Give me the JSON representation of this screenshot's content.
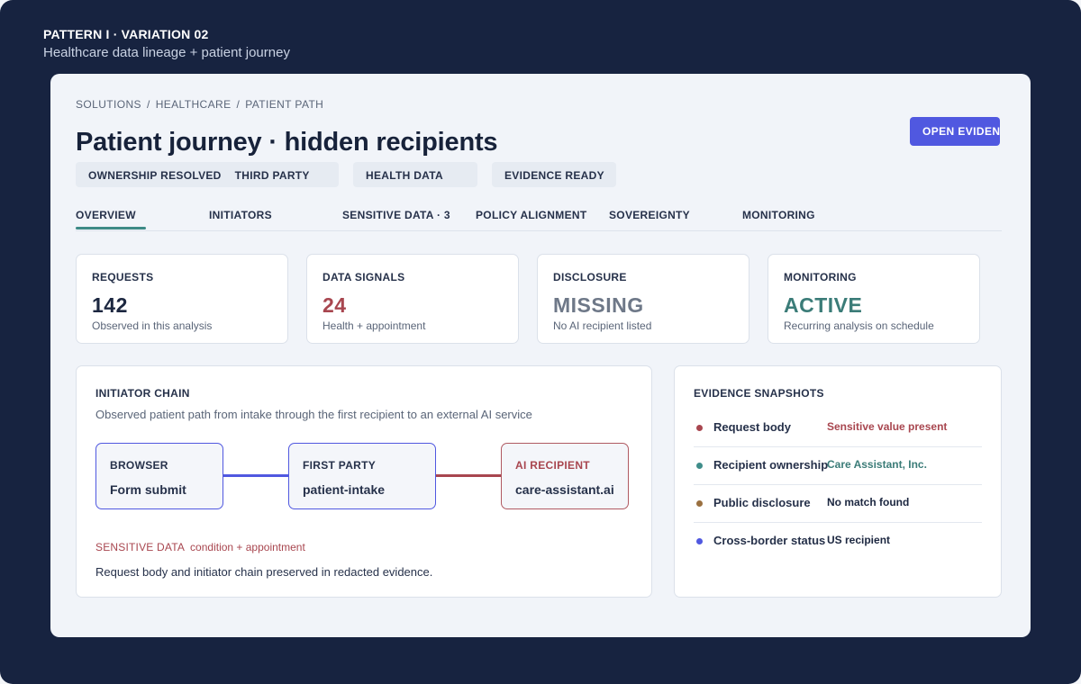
{
  "pattern": {
    "title": "PATTERN I · VARIATION 02",
    "subtitle": "Healthcare data lineage + patient journey"
  },
  "breadcrumb": [
    "SOLUTIONS",
    "HEALTHCARE",
    "PATIENT PATH"
  ],
  "breadcrumb_separator": "/",
  "page_title": "Patient journey · hidden recipients",
  "open_button_label": "OPEN EVIDENCE",
  "tags": [
    "OWNERSHIP RESOLVED",
    "THIRD PARTY",
    "HEALTH DATA",
    "EVIDENCE READY"
  ],
  "tabs": [
    {
      "label": "OVERVIEW",
      "active": true
    },
    {
      "label": "INITIATORS",
      "active": false
    },
    {
      "label": "SENSITIVE DATA · 3",
      "active": false
    },
    {
      "label": "POLICY ALIGNMENT",
      "active": false
    },
    {
      "label": "SOVEREIGNTY",
      "active": false
    },
    {
      "label": "MONITORING",
      "active": false
    }
  ],
  "stats": [
    {
      "label": "REQUESTS",
      "value": "142",
      "desc": "Observed in this analysis",
      "color": "#1c2740"
    },
    {
      "label": "DATA SIGNALS",
      "value": "24",
      "desc": "Health + appointment",
      "color": "#a8464f"
    },
    {
      "label": "DISCLOSURE",
      "value": "MISSING",
      "desc": "No AI recipient listed",
      "color": "#6e7888"
    },
    {
      "label": "MONITORING",
      "value": "ACTIVE",
      "desc": "Recurring analysis on schedule",
      "color": "#3b7c78"
    }
  ],
  "chain": {
    "title": "INITIATOR CHAIN",
    "description": "Observed patient path from intake through the first recipient to an external AI service",
    "nodes": [
      {
        "label": "BROWSER",
        "value": "Form submit"
      },
      {
        "label": "FIRST PARTY",
        "value": "patient-intake"
      },
      {
        "label": "AI RECIPIENT",
        "value": "care-assistant.ai"
      }
    ],
    "sensitive_label": "SENSITIVE DATA",
    "sensitive_detail": "condition + appointment",
    "note": "Request body and initiator chain preserved in redacted evidence."
  },
  "evidence": {
    "title": "EVIDENCE SNAPSHOTS",
    "rows": [
      {
        "label": "Request body",
        "value": "Sensitive value present",
        "dot_color": "#a8464f",
        "value_color": "#a8464f"
      },
      {
        "label": "Recipient ownership",
        "value": "Care Assistant, Inc.",
        "dot_color": "#3f8d8a",
        "value_color": "#3b7c78"
      },
      {
        "label": "Public disclosure",
        "value": "No match found",
        "dot_color": "#9a7040",
        "value_color": "#1c2740"
      },
      {
        "label": "Cross-border status",
        "value": "US recipient",
        "dot_color": "#5058e0",
        "value_color": "#1c2740"
      }
    ]
  },
  "colors": {
    "accent": "#5058e0",
    "teal": "#3d8a86",
    "alert": "#a8464f",
    "frame_background": "#172340"
  }
}
